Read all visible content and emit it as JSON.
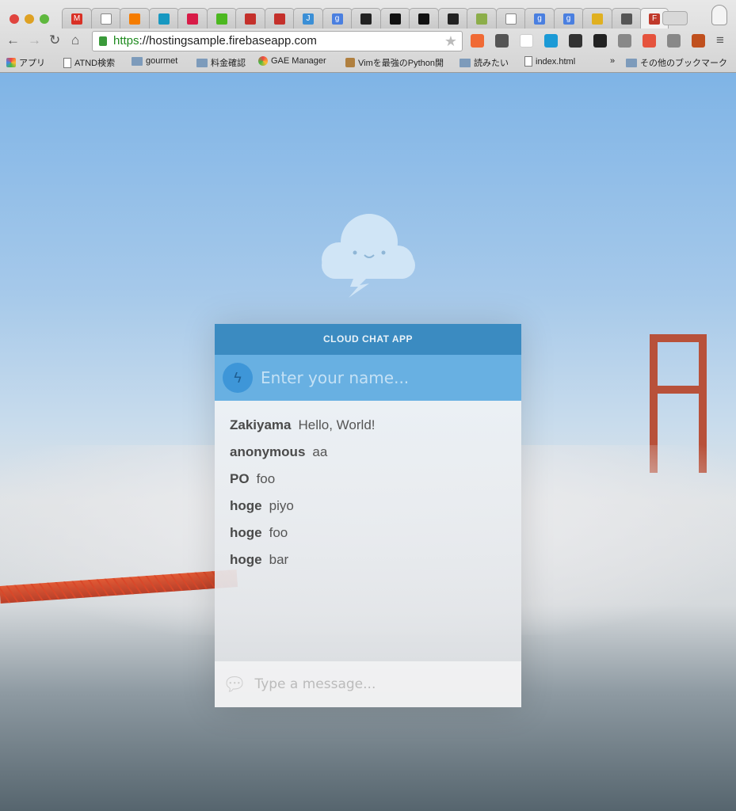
{
  "browser": {
    "tabs": [
      {
        "icon": "gmail-icon",
        "color": "#d93025",
        "label": "M"
      },
      {
        "icon": "page-icon",
        "color": "#fff"
      },
      {
        "icon": "blogger-icon",
        "color": "#f57c00"
      },
      {
        "icon": "salesforce-icon",
        "color": "#1798c1"
      },
      {
        "icon": "heart-icon",
        "color": "#d81b47"
      },
      {
        "icon": "battery-icon",
        "color": "#4cb820"
      },
      {
        "icon": "youtube-icon",
        "color": "#c4302b"
      },
      {
        "icon": "youtube-icon",
        "color": "#c4302b"
      },
      {
        "icon": "j-icon",
        "color": "#3b8fd6",
        "label": "J"
      },
      {
        "icon": "google-icon",
        "color": "#4a7fe0",
        "label": "g"
      },
      {
        "icon": "clapper-icon",
        "color": "#222"
      },
      {
        "icon": "square-icon",
        "color": "#111"
      },
      {
        "icon": "square-icon",
        "color": "#111"
      },
      {
        "icon": "clapper-icon",
        "color": "#222"
      },
      {
        "icon": "f-icon",
        "color": "#8cae4a"
      },
      {
        "icon": "page-icon",
        "color": "#fff"
      },
      {
        "icon": "google-icon",
        "color": "#4a7fe0",
        "label": "g"
      },
      {
        "icon": "google-icon",
        "color": "#4a7fe0",
        "label": "g"
      },
      {
        "icon": "database-icon",
        "color": "#e0b020"
      },
      {
        "icon": "info-icon",
        "color": "#555"
      },
      {
        "icon": "firebase-icon",
        "color": "#c0392b",
        "label": "F",
        "active": true
      }
    ],
    "url_scheme": "https",
    "url_rest": "://hostingsample.firebaseapp.com",
    "extensions": [
      {
        "icon": "ext-icon",
        "color": "#f06a35"
      },
      {
        "icon": "pocket-icon",
        "color": "#555"
      },
      {
        "icon": "wikipedia-icon",
        "color": "#fff"
      },
      {
        "icon": "y-icon",
        "color": "#1b9ad6"
      },
      {
        "icon": "gear-icon",
        "color": "#333"
      },
      {
        "icon": "ext-icon",
        "color": "#222"
      },
      {
        "icon": "cast-icon",
        "color": "#888"
      },
      {
        "icon": "ext-icon",
        "color": "#e5533d"
      },
      {
        "icon": "ext-icon",
        "color": "#888"
      },
      {
        "icon": "ext-icon",
        "color": "#c0501e"
      }
    ],
    "bookmarks": [
      {
        "icon": "apps-icon",
        "label": "アプリ"
      },
      {
        "icon": "page-icon",
        "label": "ATND検索"
      },
      {
        "icon": "folder-icon",
        "label": "gourmet"
      },
      {
        "icon": "folder-icon",
        "label": "料金確認"
      },
      {
        "icon": "chrome-icon",
        "label": "GAE Manager"
      },
      {
        "icon": "person-icon",
        "label": "Vimを最強のPython開"
      },
      {
        "icon": "folder-icon",
        "label": "読みたい"
      },
      {
        "icon": "page-icon",
        "label": "index.html"
      }
    ],
    "more": "»",
    "other_bookmarks": "その他のブックマーク"
  },
  "app": {
    "title": "CLOUD CHAT APP",
    "name_placeholder": "Enter your name...",
    "message_placeholder": "Type a message...",
    "messages": [
      {
        "name": "Zakiyama",
        "text": "Hello, World!"
      },
      {
        "name": "anonymous",
        "text": "aa"
      },
      {
        "name": "PO",
        "text": "foo"
      },
      {
        "name": "hoge",
        "text": "piyo"
      },
      {
        "name": "hoge",
        "text": "foo"
      },
      {
        "name": "hoge",
        "text": "bar"
      }
    ],
    "colors": {
      "header": "#3b8bc1",
      "name_bar": "#68b0e2"
    }
  }
}
